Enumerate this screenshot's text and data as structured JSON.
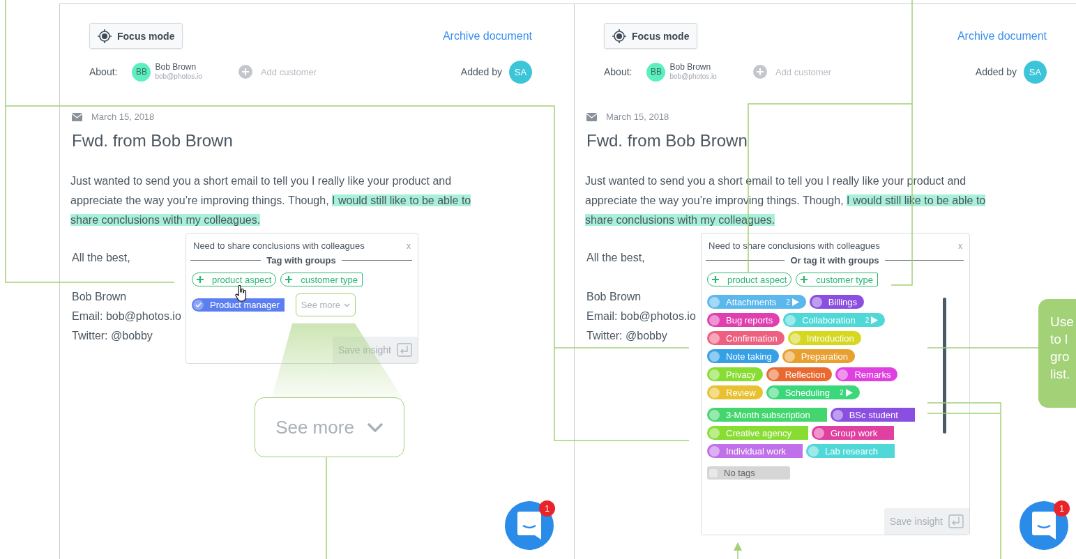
{
  "panels": [
    {
      "focus_button": "Focus mode",
      "archive_link": "Archive document",
      "about_label": "About:",
      "customer": {
        "initials": "BB",
        "name": "Bob Brown",
        "email": "bob@photos.io"
      },
      "add_customer": "Add customer",
      "added_by_label": "Added by",
      "added_by_initials": "SA",
      "email": {
        "date": "March 15, 2018",
        "title": "Fwd. from Bob Brown",
        "body": "Just wanted to send you a short email to tell you I really like your product and appreciate the way you’re improving things. Though, ",
        "highlight": "I would still like to be able to share conclusions with my colleagues.",
        "signoff": "All the best,",
        "signature": [
          "Bob Brown",
          "Email: bob@photos.io",
          "Twitter: @bobby"
        ]
      },
      "popup": {
        "kind": "compact",
        "title": "Need to share conclusions with colleagues",
        "close": "x",
        "heading": "Tag with groups",
        "add_tags": [
          "product aspect",
          "customer type"
        ],
        "chosen_tags": [
          {
            "label": "Product manager",
            "checked": true,
            "color": "#5b7ff0"
          }
        ],
        "see_more": "See more",
        "save": "Save insight"
      },
      "magnifier": {
        "text": "See more"
      },
      "chat": {
        "badge": "1"
      }
    },
    {
      "focus_button": "Focus mode",
      "archive_link": "Archive document",
      "about_label": "About:",
      "customer": {
        "initials": "BB",
        "name": "Bob Brown",
        "email": "bob@photos.io"
      },
      "add_customer": "Add customer",
      "added_by_label": "Added by",
      "added_by_initials": "SA",
      "email": {
        "date": "March 15, 2018",
        "title": "Fwd. from Bob Brown",
        "body": "Just wanted to send you a short email to tell you I really like your product and appreciate the way you’re improving things. Though, ",
        "highlight": "I would still like to be able to share conclusions with my colleagues.",
        "signoff": "All the best,",
        "signature": [
          "Bob Brown",
          "Email: bob@photos.io",
          "Twitter: @bobby"
        ]
      },
      "popup": {
        "kind": "full",
        "title": "Need to share conclusions with colleagues",
        "close": "x",
        "heading": "Or tag it with groups",
        "add_tags": [
          "product aspect",
          "customer type"
        ],
        "sections": [
          {
            "kind": "round",
            "tags": [
              {
                "label": "Attachments",
                "color": "#5bb8ec",
                "count": "2"
              },
              {
                "label": "Billings",
                "color": "#8a4fe0"
              },
              {
                "label": "Bug reports",
                "color": "#e03fb0"
              },
              {
                "label": "Collaboration",
                "color": "#4fd8d8",
                "count": "2"
              },
              {
                "label": "Confirmation",
                "color": "#ee6080"
              },
              {
                "label": "Introduction",
                "color": "#d6d820"
              },
              {
                "label": "Note taking",
                "color": "#36a0e6"
              },
              {
                "label": "Preparation",
                "color": "#e8a030"
              },
              {
                "label": "Privacy",
                "color": "#88dd33"
              },
              {
                "label": "Reflection",
                "color": "#e86a30"
              },
              {
                "label": "Remarks",
                "color": "#e040e0"
              },
              {
                "label": "Review",
                "color": "#e8c030"
              },
              {
                "label": "Scheduling",
                "color": "#3ad87a",
                "count": "2"
              }
            ]
          },
          {
            "kind": "flag",
            "tags": [
              {
                "label": "3-Month subscription",
                "color": "#44d66e"
              },
              {
                "label": "BSc student",
                "color": "#8a4fe0"
              },
              {
                "label": "Creative agency",
                "color": "#88dd33"
              },
              {
                "label": "Group work",
                "color": "#e040a0"
              },
              {
                "label": "Individual work",
                "color": "#c070e8"
              },
              {
                "label": "Lab research",
                "color": "#50d8d8"
              }
            ]
          }
        ],
        "no_tags": "No tags",
        "save": "Save insight"
      },
      "chat": {
        "badge": "1"
      }
    }
  ],
  "callout": {
    "text": "Use\nto l\ngro\nlist."
  }
}
